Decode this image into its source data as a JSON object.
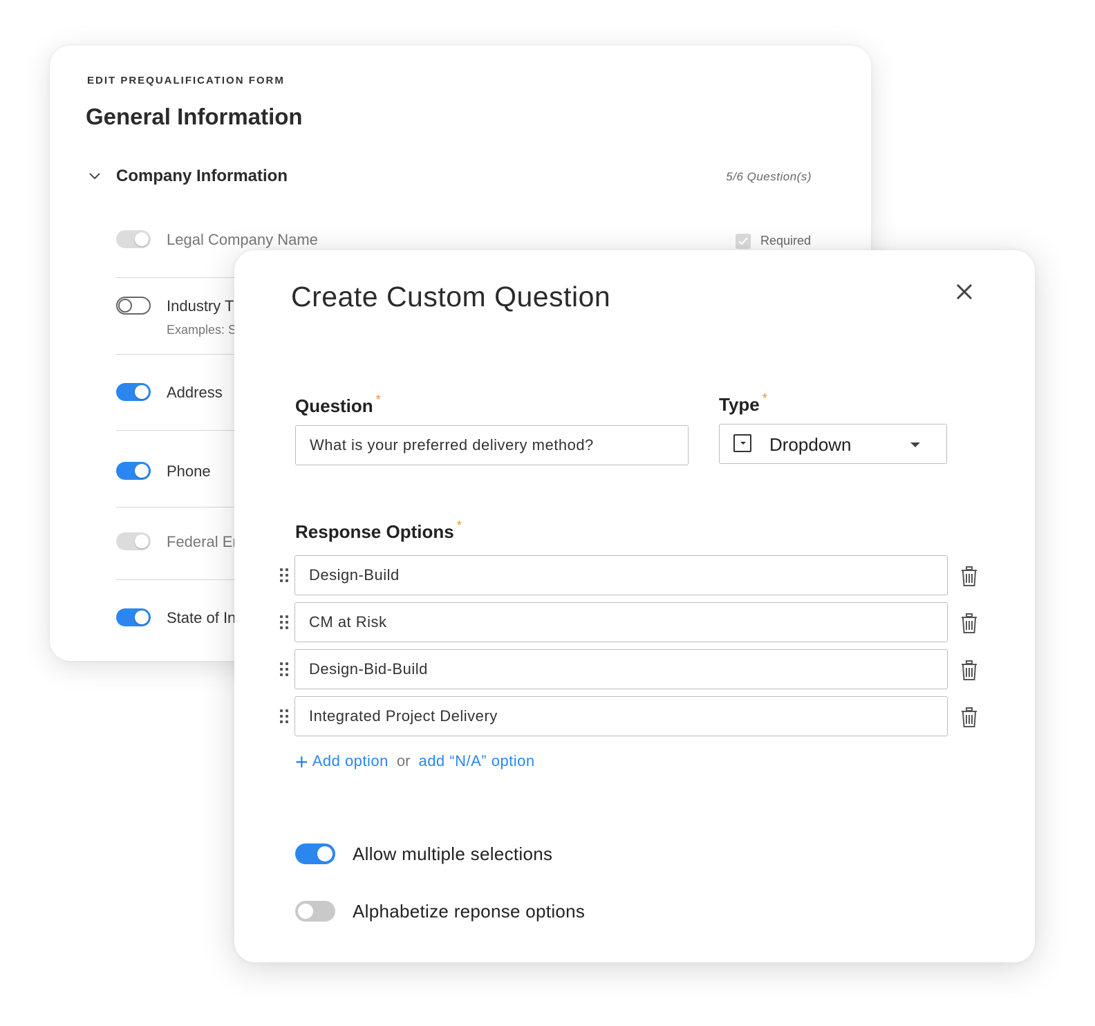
{
  "form": {
    "eyebrow": "EDIT PREQUALIFICATION FORM",
    "title": "General Information",
    "section": {
      "title": "Company Information",
      "question_count": "5/6 Question(s)"
    },
    "required_label": "Required",
    "fields": [
      {
        "label": "Legal Company Name",
        "state": "disabled-on",
        "sub": ""
      },
      {
        "label": "Industry T",
        "state": "off",
        "sub": "Examples: S"
      },
      {
        "label": "Address",
        "state": "on",
        "sub": ""
      },
      {
        "label": "Phone",
        "state": "on",
        "sub": ""
      },
      {
        "label": "Federal Er",
        "state": "disabled-on",
        "sub": ""
      },
      {
        "label": "State of In",
        "state": "on",
        "sub": ""
      }
    ]
  },
  "modal": {
    "title": "Create Custom Question",
    "close_icon": "close-icon",
    "question": {
      "label": "Question",
      "required_mark": "*",
      "value": "What is your preferred delivery method?"
    },
    "type": {
      "label": "Type",
      "required_mark": "*",
      "value": "Dropdown",
      "icon": "dropdown-type-icon"
    },
    "response_options": {
      "label": "Response Options",
      "required_mark": "*",
      "options": [
        "Design-Build",
        "CM at Risk",
        "Design-Bid-Build",
        "Integrated Project Delivery"
      ]
    },
    "add_option_label": "Add option",
    "or_label": "or",
    "add_na_label": "add “N/A” option",
    "settings": [
      {
        "label": "Allow multiple selections",
        "on": true
      },
      {
        "label": "Alphabetize reponse options",
        "on": false
      }
    ]
  },
  "colors": {
    "accent": "#2c86f0",
    "required_star": "#f38b2d",
    "toggle_off": "#c9c9c9"
  }
}
